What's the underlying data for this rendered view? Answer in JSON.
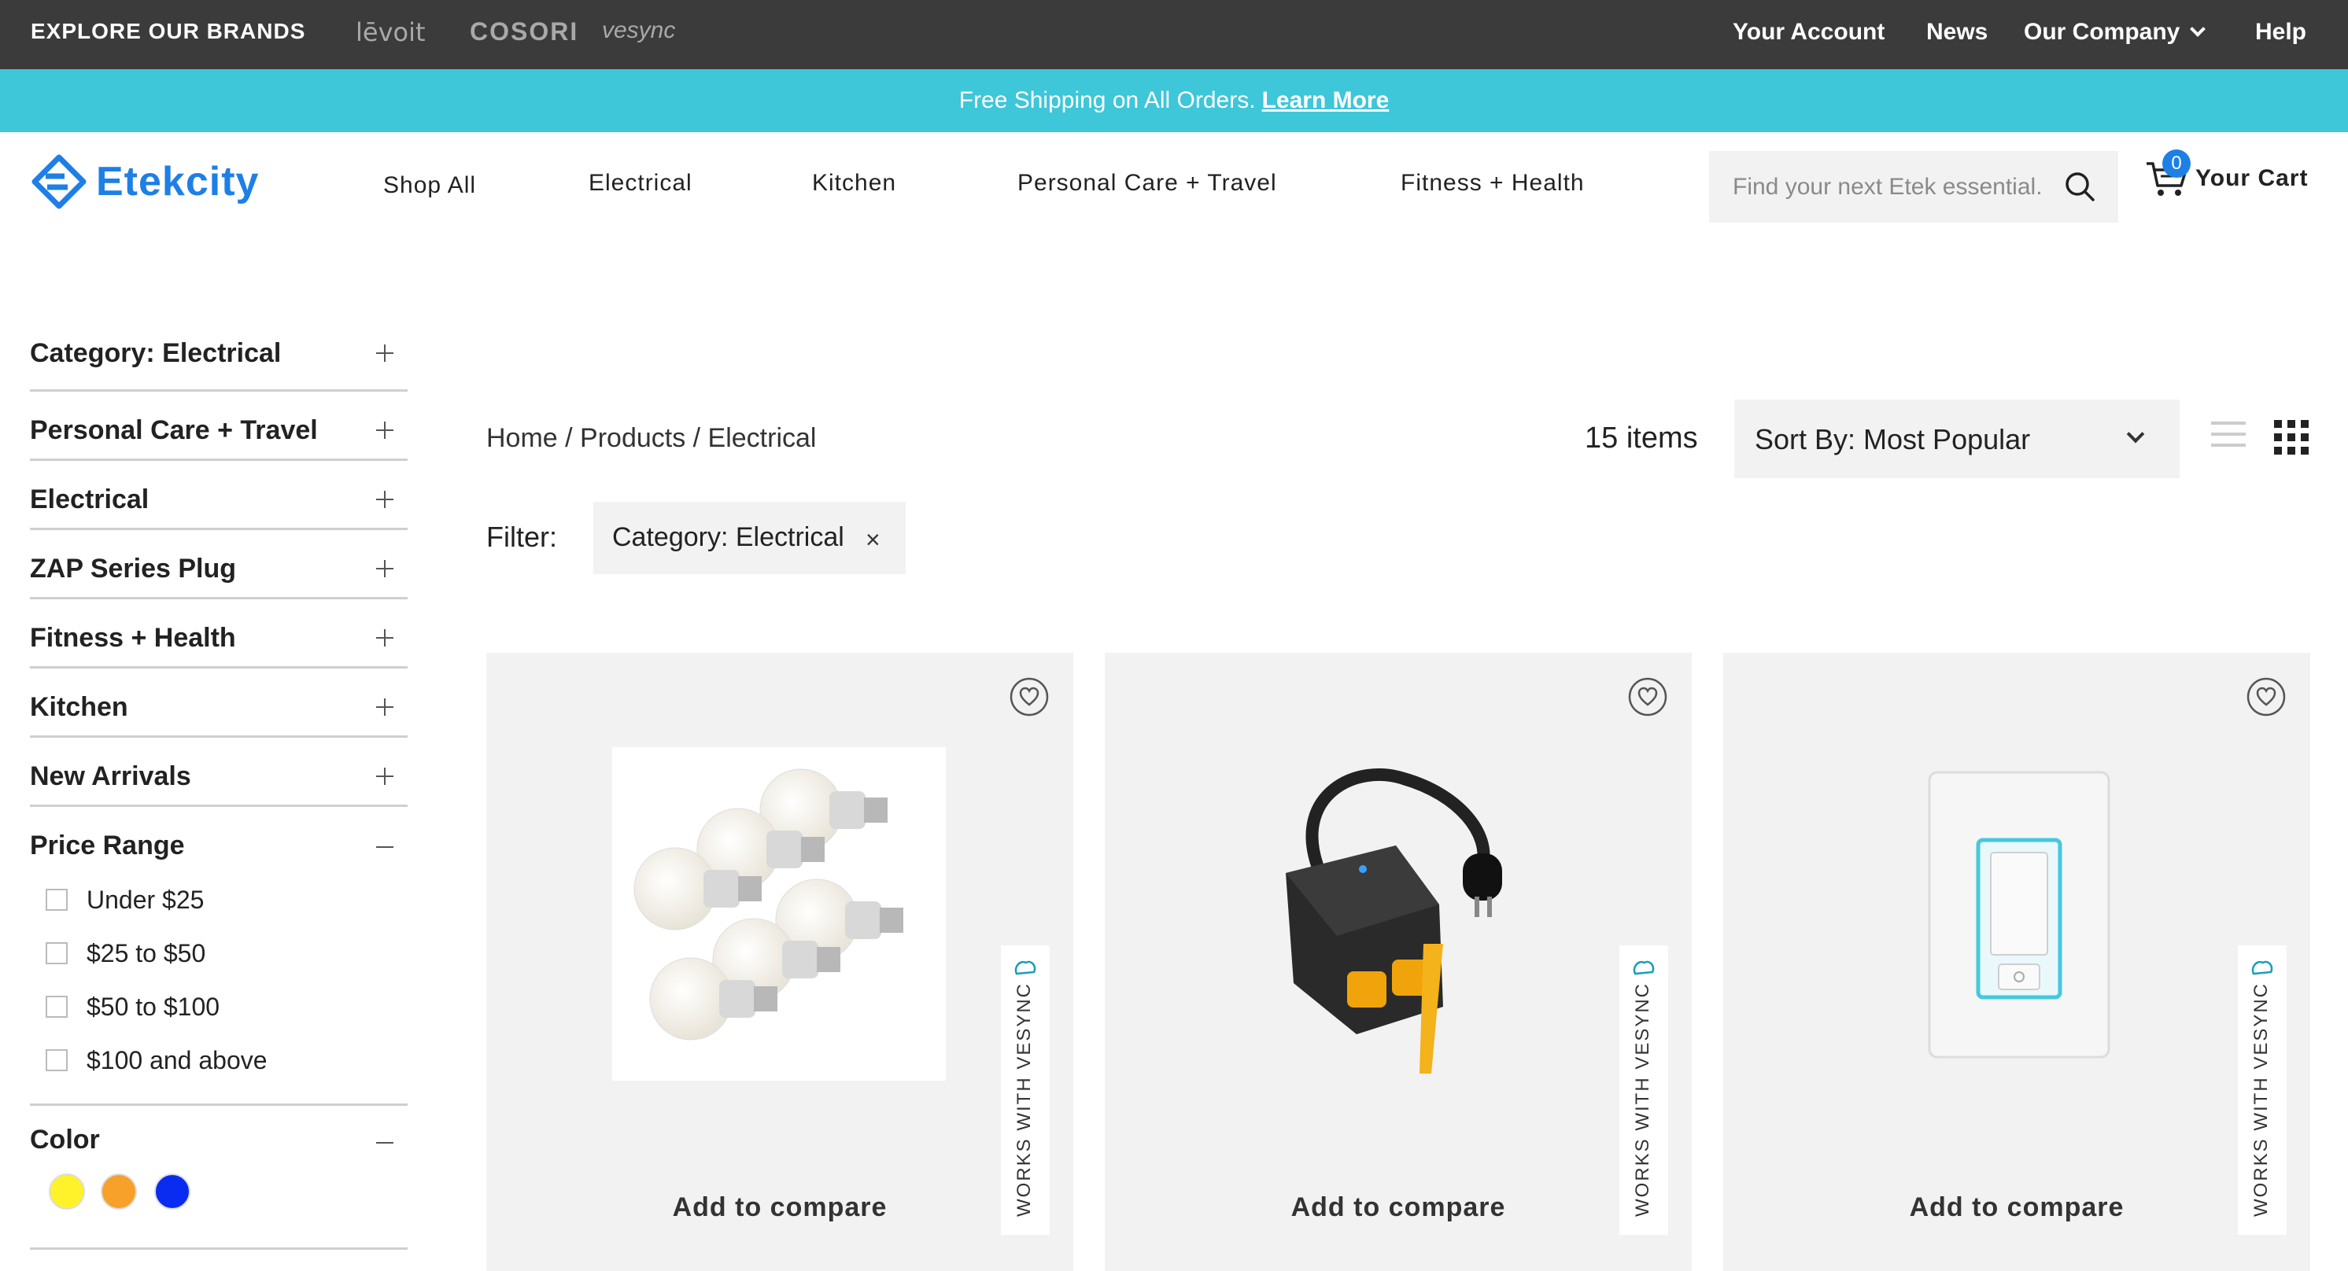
{
  "topbar": {
    "explore_label": "EXPLORE OUR BRANDS",
    "brands": [
      "lēvoit",
      "COSORI",
      "vesync"
    ],
    "links": [
      "Your Account",
      "News",
      "Our Company",
      "Help"
    ]
  },
  "banner": {
    "text": "Free Shipping on All Orders.",
    "link": "Learn More"
  },
  "header": {
    "logo_text": "Etekcity",
    "nav": [
      "Shop All",
      "Electrical",
      "Kitchen",
      "Personal Care + Travel",
      "Fitness + Health"
    ],
    "search_placeholder": "Find your next Etek essential.",
    "cart_count": "0",
    "cart_label": "Your Cart"
  },
  "sidebar": {
    "facets": [
      "Category: Electrical",
      "Personal Care + Travel",
      "Electrical",
      "ZAP Series Plug",
      "Fitness + Health",
      "Kitchen",
      "New Arrivals"
    ],
    "price_title": "Price Range",
    "price_options": [
      "Under $25",
      "$25 to $50",
      "$50 to $100",
      "$100 and above"
    ],
    "color_title": "Color",
    "colors": [
      "#fff22b",
      "#f7a02a",
      "#0a2cf0"
    ]
  },
  "main": {
    "breadcrumb": "Home / Products / Electrical",
    "item_count": "15 items",
    "sort_label": "Sort By: Most Popular",
    "filter_label": "Filter:",
    "filter_chip": "Category: Electrical",
    "chip_remove": "×"
  },
  "products": [
    {
      "badge": "WORKS WITH VESYNC",
      "compare": "Add to compare"
    },
    {
      "badge": "WORKS WITH VESYNC",
      "compare": "Add to compare"
    },
    {
      "badge": "WORKS WITH VESYNC",
      "compare": "Add to compare"
    }
  ],
  "colors": {
    "topbar_bg": "#3b3b3b",
    "banner_bg": "#3ec6d9",
    "brand_blue": "#1e7fe6",
    "card_bg": "#f2f2f2"
  }
}
